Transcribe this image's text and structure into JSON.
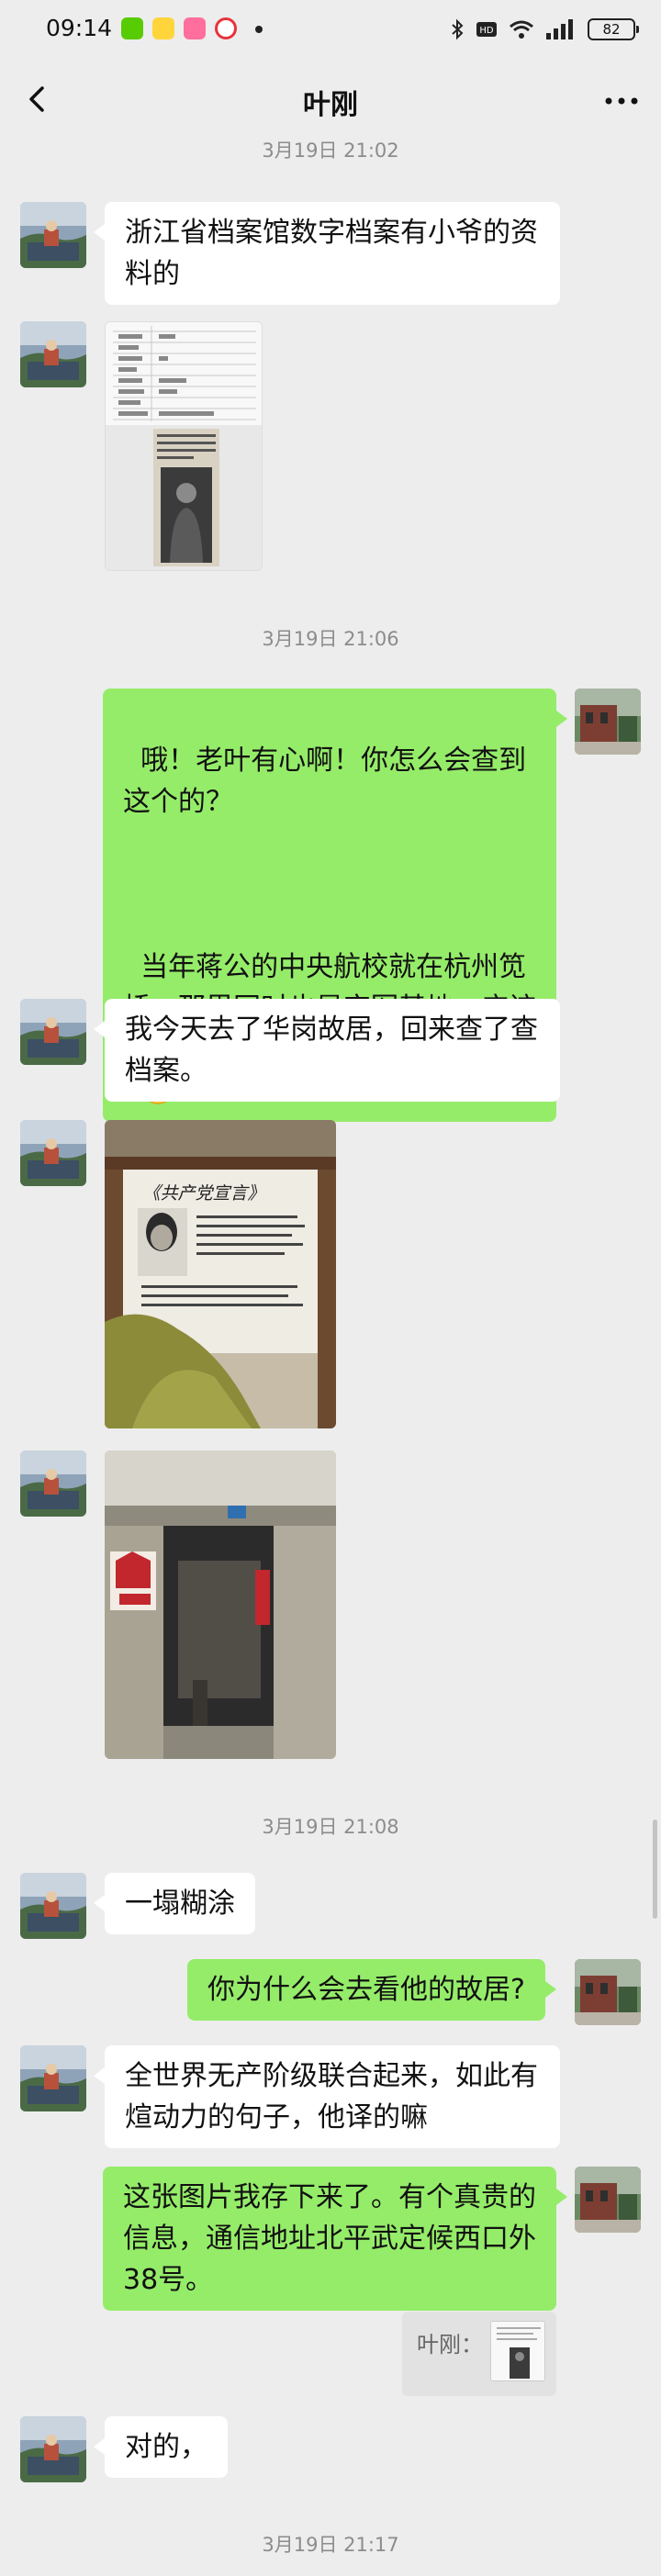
{
  "status_bar": {
    "time": "09:14",
    "battery": "82",
    "app_icons": [
      "duolingo-icon",
      "yellow-app-icon",
      "pink-app-icon",
      "red-target-app-icon"
    ],
    "system_icons": [
      "bluetooth-icon",
      "hd-icon",
      "wifi-icon",
      "signal-icon"
    ]
  },
  "nav": {
    "title": "叶刚"
  },
  "colors": {
    "background": "#ededed",
    "incoming_bubble": "#ffffff",
    "outgoing_bubble": "#95ec69",
    "timestamp_text": "#8c8c8c"
  },
  "timestamps": {
    "t1": "3月19日 21:02",
    "t2": "3月19日 21:06",
    "t3": "3月19日 21:08",
    "t4": "3月19日 21:17"
  },
  "messages": {
    "m1": "浙江省档案馆数字档案有小爷的资料的",
    "m2_p1": "哦！老叶有心啊！你怎么会查到这个的？",
    "m2_p2": "当年蒋公的中央航校就在杭州笕桥。那里同时也是空军基地。应该是有一批旧档案被共军给解放了",
    "m3": "我今天去了华岗故居，回来查了查档案。",
    "m4": "一塌糊涂",
    "m5": "你为什么会去看他的故居?",
    "m6": "全世界无产阶级联合起来，如此有煊动力的句子，他译的嘛",
    "m7": "这张图片我存下来了。有个真贵的信息，通信地址北平武定候西口外38号。",
    "m8": "对的，"
  },
  "quote": {
    "label": "叶刚："
  },
  "photo_text": {
    "poster": "《共产党宣言》"
  }
}
